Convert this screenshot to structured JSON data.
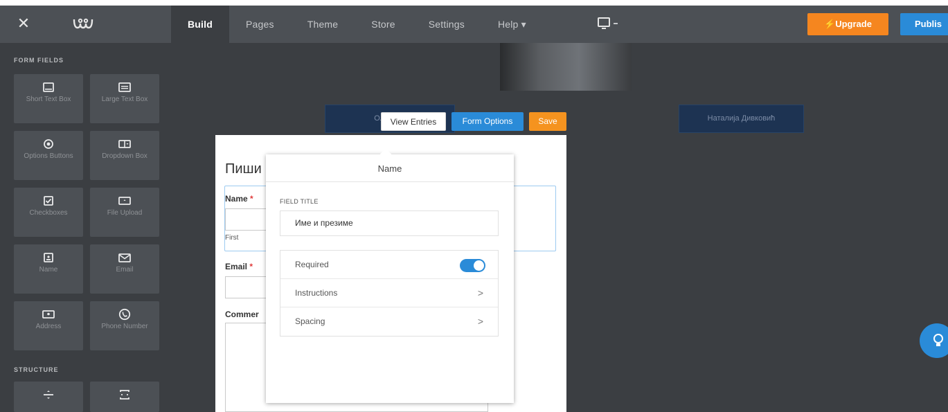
{
  "topbar": {
    "close_icon": "close-icon",
    "logo_icon": "weebly-logo-icon",
    "tabs": [
      {
        "label": "Build"
      },
      {
        "label": "Pages"
      },
      {
        "label": "Theme"
      },
      {
        "label": "Store"
      },
      {
        "label": "Settings"
      },
      {
        "label": "Help ▾"
      }
    ],
    "device_icon": "desktop-icon",
    "upgrade_label": "Upgrade",
    "publish_label": "Publis"
  },
  "sidebar": {
    "form_fields_title": "FORM FIELDS",
    "form_fields": [
      {
        "label": "Short Text Box",
        "icon": "short-text-box-icon"
      },
      {
        "label": "Large Text Box",
        "icon": "large-text-box-icon"
      },
      {
        "label": "Options Buttons",
        "icon": "options-buttons-icon"
      },
      {
        "label": "Dropdown Box",
        "icon": "dropdown-box-icon"
      },
      {
        "label": "Checkboxes",
        "icon": "checkboxes-icon"
      },
      {
        "label": "File Upload",
        "icon": "file-upload-icon"
      },
      {
        "label": "Name",
        "icon": "name-icon"
      },
      {
        "label": "Email",
        "icon": "email-icon"
      },
      {
        "label": "Address",
        "icon": "address-icon"
      },
      {
        "label": "Phone Number",
        "icon": "phone-icon"
      }
    ],
    "structure_title": "STRUCTURE",
    "structure": [
      {
        "icon": "divider-icon"
      },
      {
        "icon": "spacer-icon"
      }
    ]
  },
  "canvas": {
    "left_dark_button": "Оливица",
    "right_dark_button": "Наталија Дивковић",
    "view_entries": "View Entries",
    "form_options": "Form Options",
    "save": "Save",
    "form_title": "Пиши",
    "name_label": "Name",
    "first_sub": "First",
    "email_label": "Email",
    "comment_label": "Commer",
    "required_mark": "*"
  },
  "popover": {
    "title": "Name",
    "field_title_label": "FIELD TITLE",
    "field_title_value": "Име и презиме",
    "options": [
      {
        "label": "Required",
        "type": "toggle",
        "on": true
      },
      {
        "label": "Instructions",
        "type": "chevron"
      },
      {
        "label": "Spacing",
        "type": "chevron"
      }
    ]
  },
  "colors": {
    "topbar": "#4c5055",
    "sidebar": "#3b3e42",
    "upgrade": "#f5861f",
    "publish": "#2a8bd8",
    "accent_blue": "#2a8bd8",
    "save_orange": "#f5931f"
  }
}
